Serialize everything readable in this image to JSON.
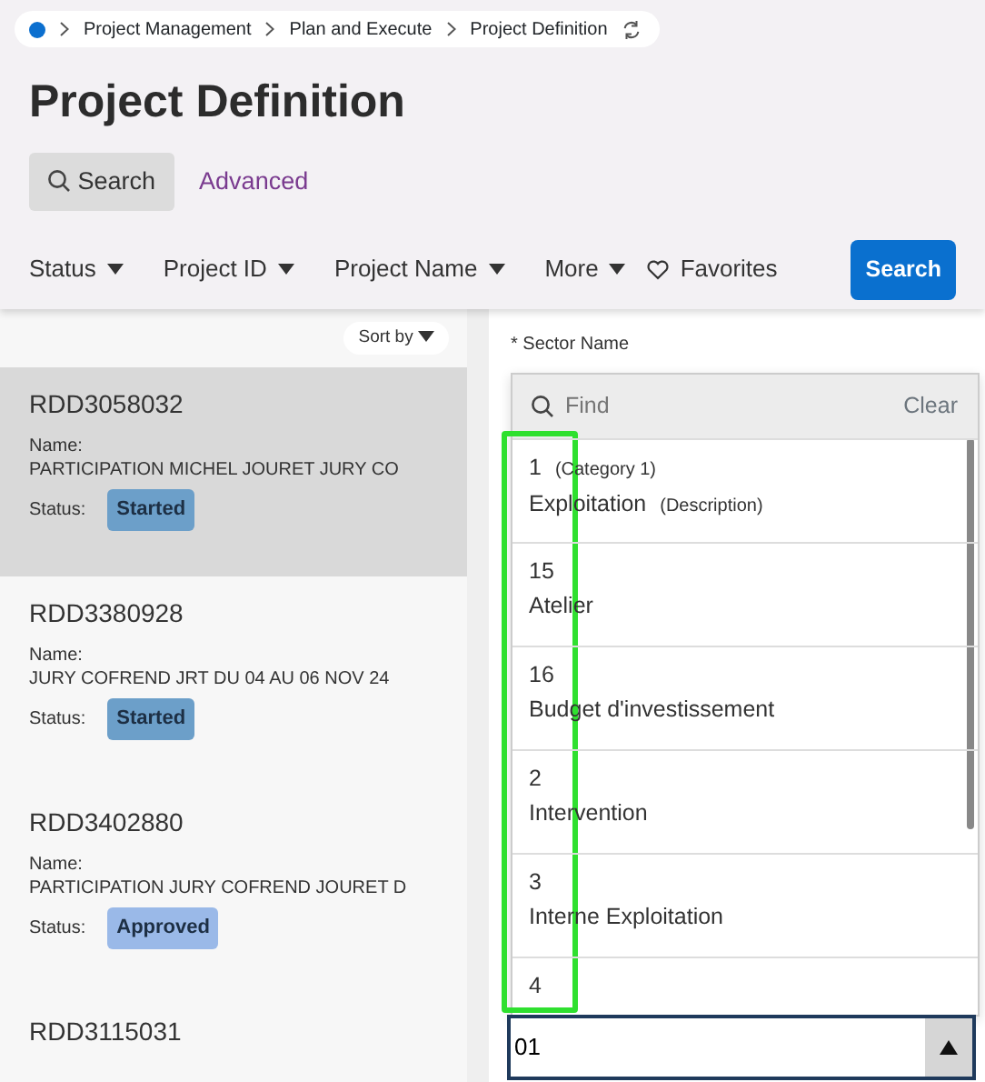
{
  "breadcrumb": [
    "Project Management",
    "Plan and Execute",
    "Project Definition"
  ],
  "title": "Project Definition",
  "search_tabs": [
    {
      "label": "Search",
      "selected": true
    },
    {
      "label": "Advanced",
      "selected": false
    }
  ],
  "filters": [
    "Status",
    "Project ID",
    "Project Name",
    "More"
  ],
  "favorites": "Favorites",
  "search_button": "Search",
  "sort_by": "Sort by",
  "projects": [
    {
      "id": "RDD3058032",
      "name_label": "Name:",
      "name": "PARTICIPATION MICHEL JOURET JURY CO",
      "status_label": "Status:",
      "status": "Started",
      "color": "#6c9fc9",
      "selected": true
    },
    {
      "id": "RDD3380928",
      "name_label": "Name:",
      "name": "JURY COFREND JRT DU 04 AU 06 NOV 24",
      "status_label": "Status:",
      "status": "Started",
      "color": "#6c9fc9",
      "selected": false
    },
    {
      "id": "RDD3402880",
      "name_label": "Name:",
      "name": "PARTICIPATION JURY COFREND JOURET D",
      "status_label": "Status:",
      "status": "Approved",
      "color": "#9ab9e8",
      "selected": false
    },
    {
      "id": "RDD3115031",
      "selected": false
    }
  ],
  "sector": {
    "label": "* Sector Name",
    "find_placeholder": "Find",
    "clear": "Clear",
    "value": "01",
    "options": [
      {
        "code": "1",
        "code_note": "(Category 1)",
        "description": "Exploitation",
        "description_note": "(Description)"
      },
      {
        "code": "15",
        "description": "Atelier"
      },
      {
        "code": "16",
        "description": "Budget d'investissement"
      },
      {
        "code": "2",
        "description": "Intervention"
      },
      {
        "code": "3",
        "description": "Interne Exploitation"
      },
      {
        "code": "4"
      }
    ]
  }
}
